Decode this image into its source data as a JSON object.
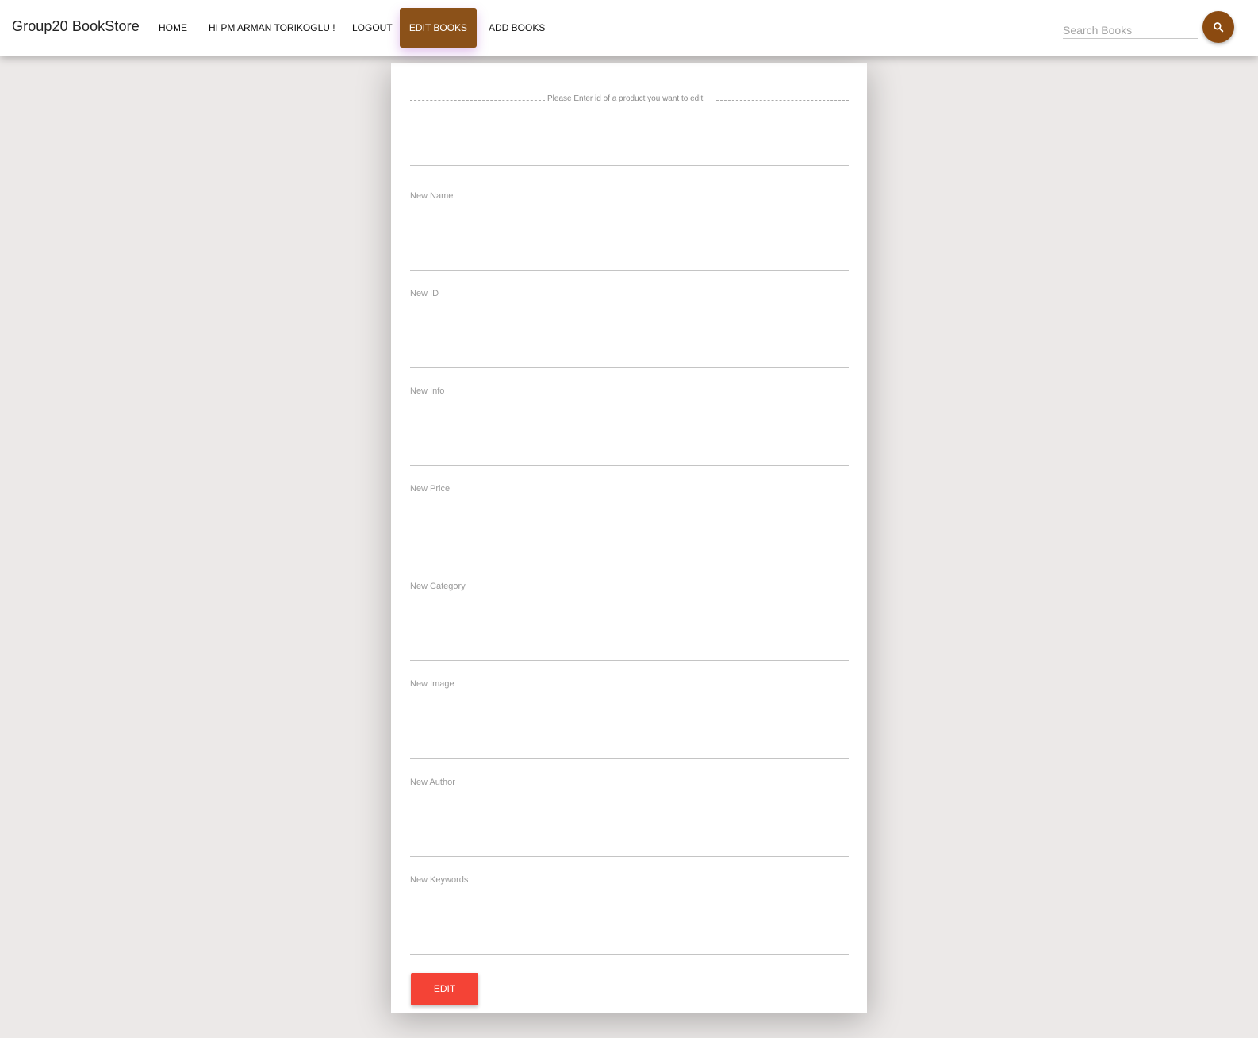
{
  "app": {
    "brand": "Group20 BookStore"
  },
  "nav": {
    "home": "HOME",
    "greeting": "HI PM ARMAN TORIKOGLU !",
    "logout": "LOGOUT",
    "edit_books": "EDIT BOOKS",
    "add_books": "ADD BOOKS"
  },
  "search": {
    "placeholder": "Search Books",
    "icon": "search-icon"
  },
  "form": {
    "legend": "Please Enter id of a product you want to edit",
    "id_field_value": "",
    "fields": [
      {
        "label": "New Name",
        "value": ""
      },
      {
        "label": "New ID",
        "value": ""
      },
      {
        "label": "New Info",
        "value": ""
      },
      {
        "label": "New Price",
        "value": ""
      },
      {
        "label": "New Category",
        "value": ""
      },
      {
        "label": "New Image",
        "value": ""
      },
      {
        "label": "New Author",
        "value": ""
      },
      {
        "label": "New Keywords",
        "value": ""
      }
    ],
    "submit_label": "EDIT"
  },
  "colors": {
    "background": "#ece9e8",
    "nav_active": "#8b5119",
    "search_button": "#8b4a10",
    "submit_button": "#f44336"
  }
}
